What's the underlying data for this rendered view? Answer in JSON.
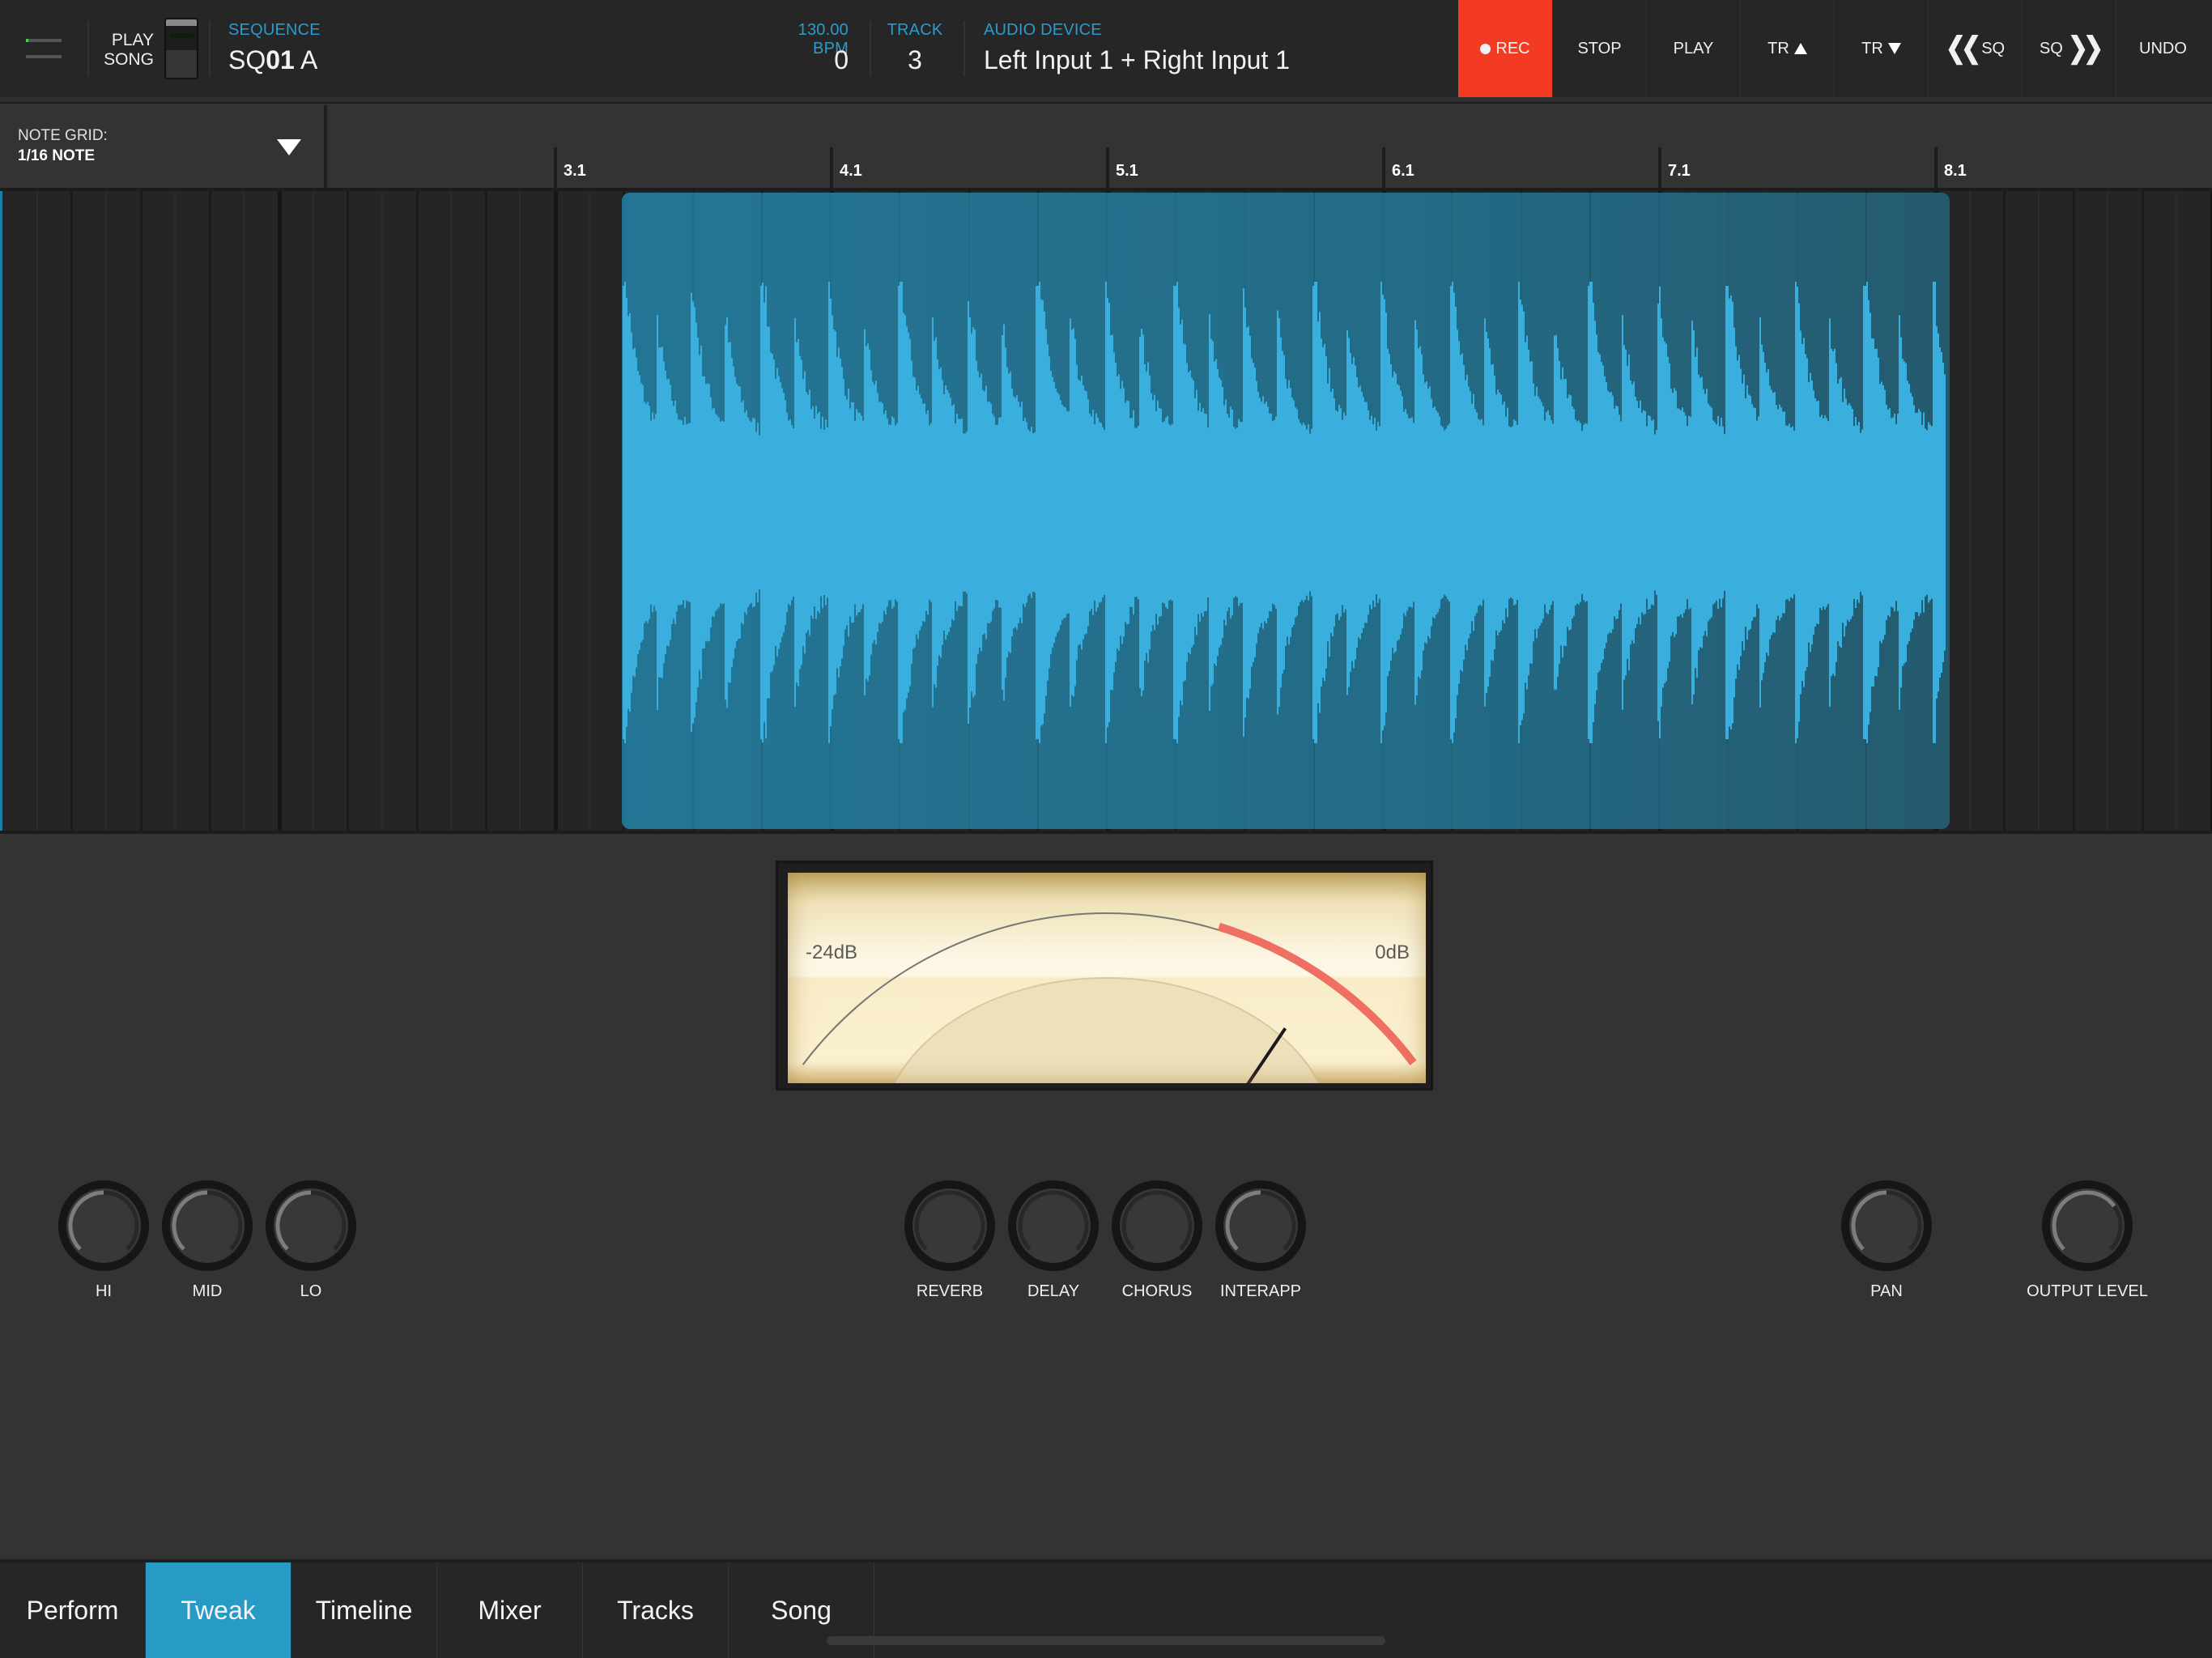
{
  "header": {
    "play_song": {
      "line1": "PLAY",
      "line2": "SONG"
    },
    "sequence": {
      "label": "SEQUENCE",
      "prefix": "SQ",
      "number": "01",
      "suffix": " A"
    },
    "bpm": {
      "label": "130.00 BPM",
      "value": "0"
    },
    "track": {
      "label": "TRACK",
      "value": "3"
    },
    "audio_device": {
      "label": "AUDIO DEVICE",
      "value": "Left Input 1 + Right Input 1"
    },
    "transport": [
      {
        "id": "rec",
        "label": "REC",
        "icon": "record-dot-icon"
      },
      {
        "id": "stop",
        "label": "STOP"
      },
      {
        "id": "play",
        "label": "PLAY"
      },
      {
        "id": "track-up",
        "label": "TR",
        "icon": "triangle-up-icon"
      },
      {
        "id": "track-down",
        "label": "TR",
        "icon": "triangle-down-icon"
      },
      {
        "id": "seq-prev",
        "label": "SQ",
        "icon": "double-chevron-left-icon"
      },
      {
        "id": "seq-next",
        "label": "SQ",
        "icon": "double-chevron-right-icon"
      },
      {
        "id": "undo",
        "label": "UNDO"
      }
    ],
    "rec_color": "#f33a22",
    "accent_color": "#2a9bcc"
  },
  "note_grid": {
    "label": "NOTE GRID:",
    "value": "1/16 NOTE"
  },
  "ruler": {
    "bars": [
      "3.1",
      "4.1",
      "5.1",
      "6.1",
      "7.1",
      "8.1"
    ]
  },
  "vu_meter": {
    "min_label": "-24dB",
    "max_label": "0dB",
    "level_fraction": 0.82
  },
  "knobs": [
    {
      "label": "HI",
      "value": 0.5
    },
    {
      "label": "MID",
      "value": 0.5
    },
    {
      "label": "LO",
      "value": 0.5
    },
    {
      "label": "REVERB",
      "value": 0.0
    },
    {
      "label": "DELAY",
      "value": 0.0
    },
    {
      "label": "CHORUS",
      "value": 0.0
    },
    {
      "label": "INTERAPP",
      "value": 0.5
    },
    {
      "label": "PAN",
      "value": 0.5
    },
    {
      "label": "OUTPUT LEVEL",
      "value": 0.7
    }
  ],
  "tabs": [
    {
      "label": "Perform",
      "active": false
    },
    {
      "label": "Tweak",
      "active": true
    },
    {
      "label": "Timeline",
      "active": false
    },
    {
      "label": "Mixer",
      "active": false
    },
    {
      "label": "Tracks",
      "active": false
    },
    {
      "label": "Song",
      "active": false
    }
  ]
}
